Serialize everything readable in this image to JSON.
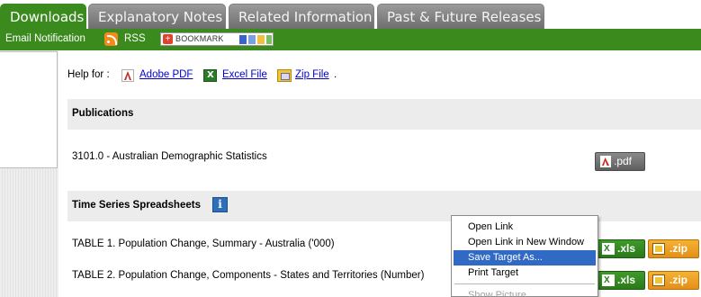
{
  "tabs": [
    {
      "label": "Downloads",
      "active": true
    },
    {
      "label": "Explanatory Notes",
      "active": false
    },
    {
      "label": "Related Information",
      "active": false
    },
    {
      "label": "Past & Future Releases",
      "active": false
    }
  ],
  "greenbar": {
    "email_label": "Email Notification",
    "rss_label": "RSS",
    "bookmark_label": "BOOKMARK",
    "bookmark_plus": "+"
  },
  "help": {
    "prefix": "Help for :",
    "links": [
      "Adobe PDF",
      "Excel File",
      "Zip File"
    ],
    "suffix": "."
  },
  "publications": {
    "title": "Publications",
    "items": [
      {
        "text": "3101.0 - Australian Demographic Statistics",
        "button": ".pdf"
      }
    ]
  },
  "time_series": {
    "title": "Time Series Spreadsheets",
    "info_glyph": "i",
    "rows": [
      {
        "text": "TABLE 1. Population Change, Summary - Australia ('000)",
        "xls": ".xls",
        "zip": ".zip"
      },
      {
        "text": "TABLE 2. Population Change, Components - States and Territories (Number)",
        "xls": ".xls",
        "zip": ".zip"
      }
    ]
  },
  "context_menu": {
    "items": [
      {
        "label": "Open Link",
        "highlighted": false,
        "disabled": false
      },
      {
        "label": "Open Link in New Window",
        "highlighted": false,
        "disabled": false
      },
      {
        "label": "Save Target As...",
        "highlighted": true,
        "disabled": false
      },
      {
        "label": "Print Target",
        "highlighted": false,
        "disabled": false
      },
      {
        "label": "Show Picture",
        "highlighted": false,
        "disabled": true
      }
    ]
  },
  "colors": {
    "brand_green": "#3b8a1e",
    "highlight_blue": "#316ac5",
    "xls_green": "#2a7a1a",
    "zip_orange": "#e3901a"
  }
}
